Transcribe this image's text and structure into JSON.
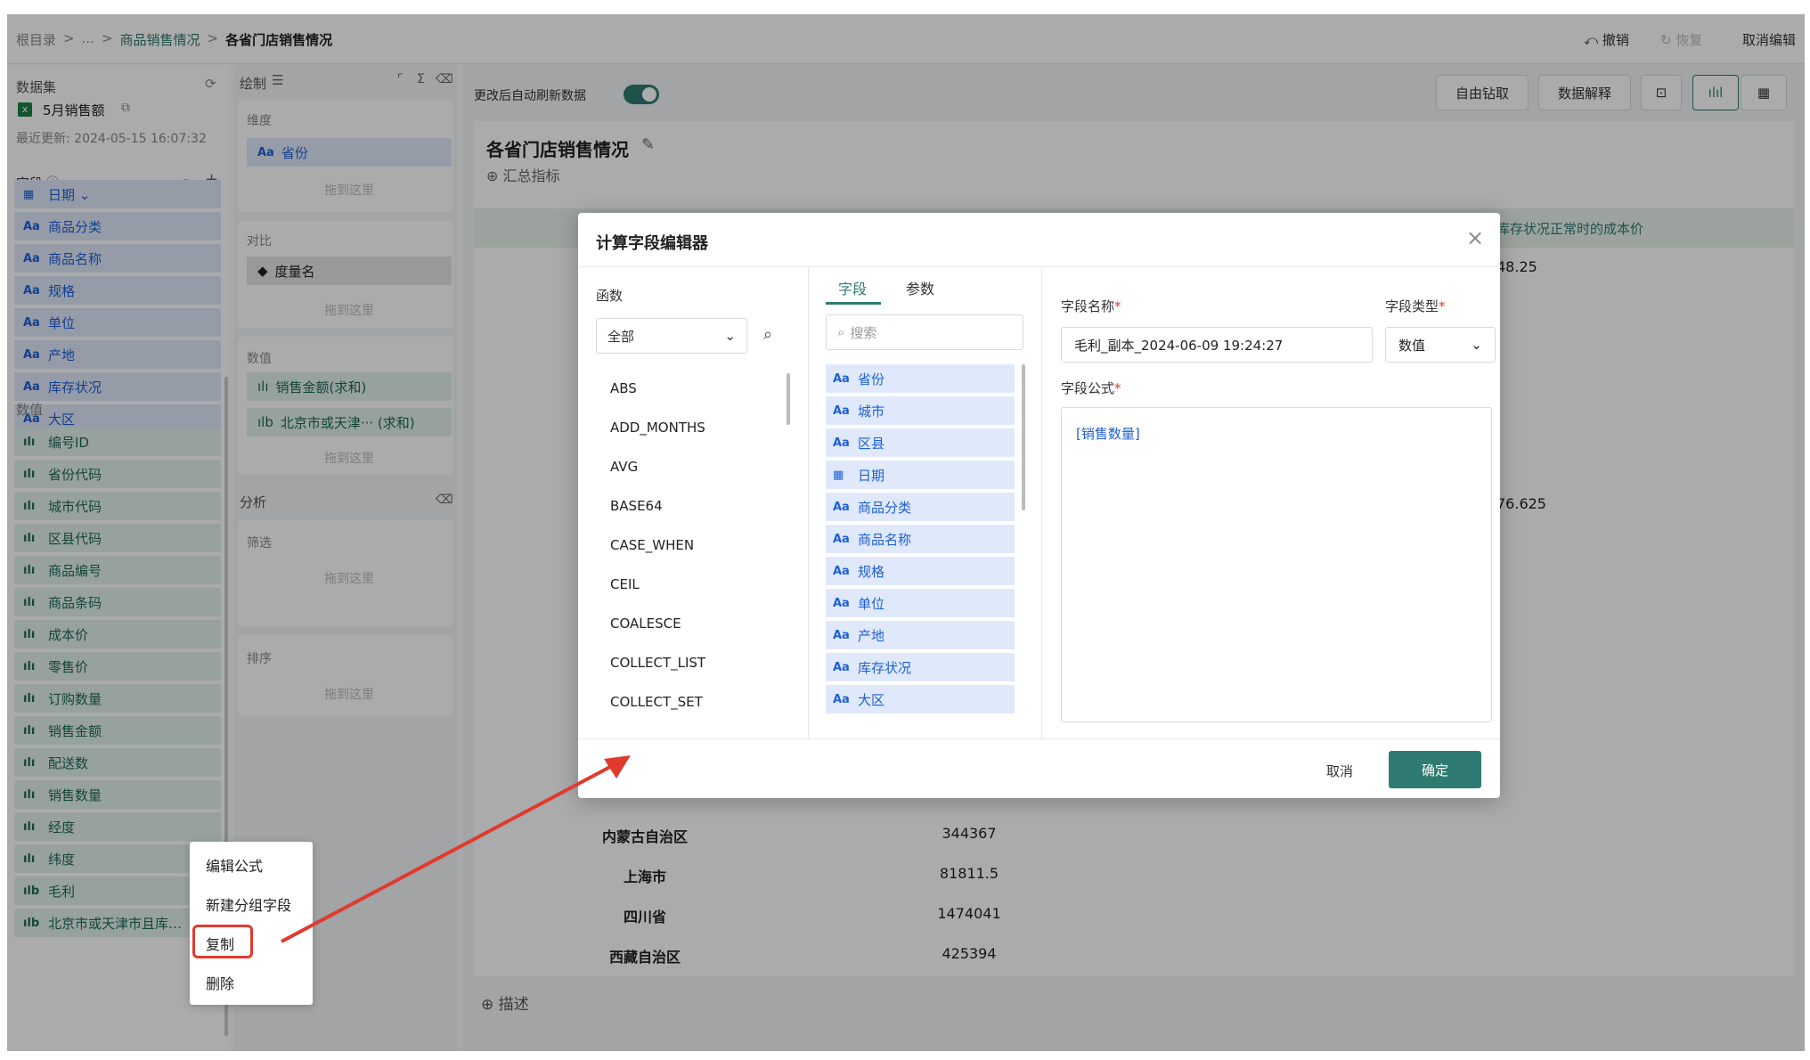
{
  "breadcrumb": {
    "root": "根目录",
    "sep": ">",
    "ellipsis": "...",
    "parent": "商品销售情况",
    "current": "各省门店销售情况"
  },
  "topbar": {
    "undo": "撤销",
    "redo": "恢复",
    "cancel_edit": "取消编辑"
  },
  "dataset": {
    "section": "数据集",
    "name": "5月销售额",
    "updated": "最近更新: 2024-05-15 16:07:32"
  },
  "fields": {
    "section": "字段",
    "dimension_items": [
      {
        "icon": "date",
        "label": "日期 ⌄"
      },
      {
        "icon": "Aa",
        "label": "商品分类"
      },
      {
        "icon": "Aa",
        "label": "商品名称"
      },
      {
        "icon": "Aa",
        "label": "规格"
      },
      {
        "icon": "Aa",
        "label": "单位"
      },
      {
        "icon": "Aa",
        "label": "产地"
      },
      {
        "icon": "Aa",
        "label": "库存状况"
      },
      {
        "icon": "Aa",
        "label": "大区"
      }
    ],
    "numeric_section": "数值",
    "numeric_items": [
      {
        "icon": "bar",
        "label": "编号ID"
      },
      {
        "icon": "bar",
        "label": "省份代码"
      },
      {
        "icon": "bar",
        "label": "城市代码"
      },
      {
        "icon": "bar",
        "label": "区县代码"
      },
      {
        "icon": "bar",
        "label": "商品编号"
      },
      {
        "icon": "bar",
        "label": "商品条码"
      },
      {
        "icon": "bar",
        "label": "成本价"
      },
      {
        "icon": "bar",
        "label": "零售价"
      },
      {
        "icon": "bar",
        "label": "订购数量"
      },
      {
        "icon": "bar",
        "label": "销售金额"
      },
      {
        "icon": "bar",
        "label": "配送数"
      },
      {
        "icon": "bar",
        "label": "销售数量"
      },
      {
        "icon": "bar",
        "label": "经度"
      },
      {
        "icon": "bar",
        "label": "纬度"
      },
      {
        "icon": "calc",
        "label": "毛利"
      },
      {
        "icon": "calc",
        "label": "北京市或天津市且库…"
      }
    ]
  },
  "build": {
    "section": "绘制",
    "dimension": "维度",
    "dimension_chip": "省份",
    "compare": "对比",
    "compare_chip": "度量名",
    "values": "数值",
    "value_chip_1": "销售金额(求和)",
    "value_chip_2": "北京市或天津··· (求和)",
    "drop_hint": "拖到这里",
    "analysis": "分析",
    "filter": "筛选",
    "sort": "排序"
  },
  "canvas": {
    "auto_refresh": "更改后自动刷新数据",
    "free_drill": "自由钻取",
    "data_explain": "数据解释",
    "chart_title": "各省门店销售情况",
    "summary_metric": "汇总指标",
    "describe": "描述",
    "header_partial": "库存状况正常时的成本价",
    "partial_1": "48.25",
    "partial_2": "76.625",
    "rows": [
      {
        "province": "内蒙古自治区",
        "value": "344367"
      },
      {
        "province": "上海市",
        "value": "81811.5"
      },
      {
        "province": "四川省",
        "value": "1474041"
      },
      {
        "province": "西藏自治区",
        "value": "425394"
      }
    ]
  },
  "modal": {
    "title": "计算字段编辑器",
    "functions_label": "函数",
    "function_filter": "全部",
    "functions": [
      "ABS",
      "ADD_MONTHS",
      "AVG",
      "BASE64",
      "CASE_WHEN",
      "CEIL",
      "COALESCE",
      "COLLECT_LIST",
      "COLLECT_SET"
    ],
    "tab_fields": "字段",
    "tab_params": "参数",
    "search_placeholder": "搜索",
    "field_list": [
      {
        "icon": "Aa",
        "label": "省份"
      },
      {
        "icon": "Aa",
        "label": "城市"
      },
      {
        "icon": "Aa",
        "label": "区县"
      },
      {
        "icon": "date",
        "label": "日期"
      },
      {
        "icon": "Aa",
        "label": "商品分类"
      },
      {
        "icon": "Aa",
        "label": "商品名称"
      },
      {
        "icon": "Aa",
        "label": "规格"
      },
      {
        "icon": "Aa",
        "label": "单位"
      },
      {
        "icon": "Aa",
        "label": "产地"
      },
      {
        "icon": "Aa",
        "label": "库存状况"
      },
      {
        "icon": "Aa",
        "label": "大区"
      }
    ],
    "name_label": "字段名称",
    "name_value": "毛利_副本_2024-06-09 19:24:27",
    "type_label": "字段类型",
    "type_value": "数值",
    "formula_label": "字段公式",
    "formula_value": "[销售数量]",
    "required": "*",
    "cancel": "取消",
    "confirm": "确定"
  },
  "context_menu": {
    "edit_formula": "编辑公式",
    "new_group": "新建分组字段",
    "copy": "复制",
    "delete": "删除"
  },
  "colors": {
    "accent": "#2f7b72",
    "annotation": "#e03a2f",
    "dimension_bg": "#dfe9fb",
    "numeric_bg": "#e2f1ec"
  }
}
